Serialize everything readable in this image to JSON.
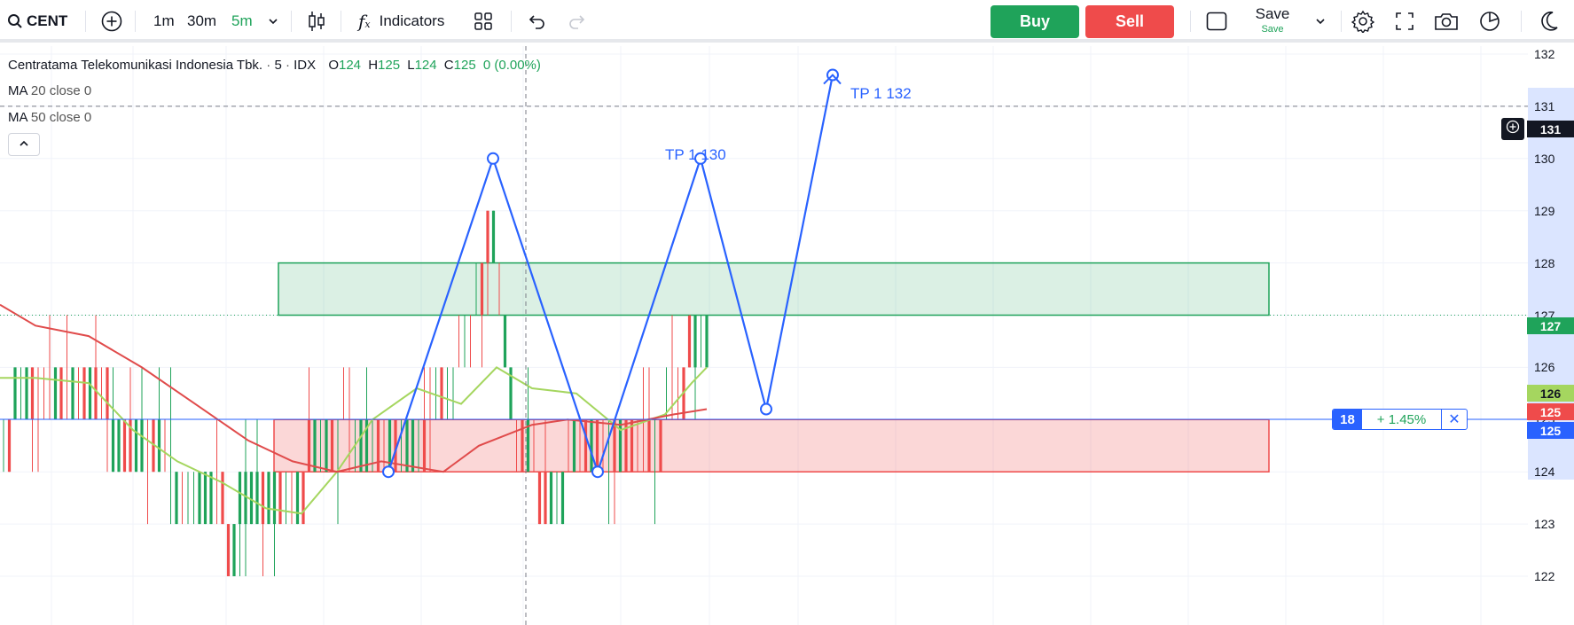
{
  "toolbar": {
    "symbol": "CENT",
    "intervals": [
      "1m",
      "30m",
      "5m"
    ],
    "active_interval": "5m",
    "indicators_label": "Indicators",
    "buy_label": "Buy",
    "sell_label": "Sell",
    "save_label": "Save",
    "save_sublabel": "Save"
  },
  "legend": {
    "symbol_name": "Centratama Telekomunikasi Indonesia Tbk.",
    "interval": "5",
    "exchange": "IDX",
    "ohlc": {
      "o_label": "O",
      "o": "124",
      "h_label": "H",
      "h": "125",
      "l_label": "L",
      "l": "124",
      "c_label": "C",
      "c": "125",
      "change": "0 (0.00%)"
    },
    "ma1": {
      "name": "MA",
      "params": "20 close 0"
    },
    "ma2": {
      "name": "MA",
      "params": "50 close 0"
    }
  },
  "price_axis": {
    "ticks": [
      "132",
      "131",
      "130",
      "129",
      "128",
      "127",
      "126",
      "125",
      "124",
      "123",
      "122"
    ],
    "crosshair_label": "131",
    "zone_label": "127",
    "ma20_label": "126",
    "last_label": "125",
    "position_label": "125",
    "colors": {
      "crosshair": "#131722",
      "zone": "#1fa35a",
      "ma20": "#a5d65f",
      "last": "#ef4b4b",
      "position": "#2962ff"
    }
  },
  "position": {
    "qty": "18",
    "pct": "+ 1.45%",
    "close": "✕"
  },
  "annotations": [
    {
      "text": "TP 1 130"
    },
    {
      "text": "TP 1 132"
    }
  ],
  "chart_data": {
    "type": "candlestick",
    "ylim": [
      121.3,
      132.9
    ],
    "zones": [
      {
        "kind": "supply",
        "color": "#1fa35a",
        "top": 128,
        "bottom": 127
      },
      {
        "kind": "demand",
        "color": "#ef4b4b",
        "top": 125,
        "bottom": 124
      }
    ],
    "pattern_prices": [
      124,
      130,
      124,
      130,
      125.2,
      131.6
    ],
    "colors": {
      "up": "#1fa35a",
      "down": "#ef4b4b",
      "ma20": "#a5d65f",
      "ma50": "#e04b4b",
      "pattern": "#2962ff"
    }
  },
  "icons": [
    "search-icon",
    "add-symbol-icon",
    "chevron-down-icon",
    "candles-icon",
    "fx-icon",
    "templates-icon",
    "undo-icon",
    "redo-icon",
    "layout-icon",
    "settings-icon",
    "fullscreen-icon",
    "camera-icon",
    "pie-icon",
    "moon-icon",
    "chevron-up-icon",
    "plus-icon"
  ]
}
